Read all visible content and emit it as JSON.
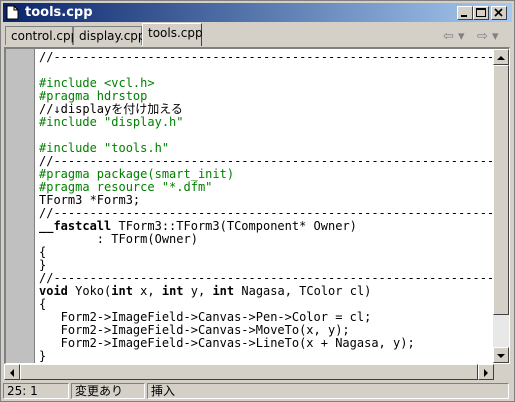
{
  "window": {
    "title": "tools.cpp",
    "icon": "document-icon"
  },
  "title_buttons": [
    "minimize-icon",
    "maximize-icon",
    "close-icon"
  ],
  "tabs": [
    {
      "label": "control.cpp",
      "active": false
    },
    {
      "label": "display.cpp",
      "active": false
    },
    {
      "label": "tools.cpp",
      "active": true
    }
  ],
  "nav": {
    "back": "⇦ ▾",
    "forward": "⇨ ▾"
  },
  "code": {
    "lines": [
      "//---------------------------------------------------------------------------",
      "",
      "#include <vcl.h>",
      "#pragma hdrstop",
      "//↓displayを付け加える",
      "#include \"display.h\"",
      "",
      "#include \"tools.h\"",
      "//---------------------------------------------------------------------------",
      "#pragma package(smart_init)",
      "#pragma resource \"*.dfm\"",
      "TForm3 *Form3;",
      "//---------------------------------------------------------------------------",
      "__fastcall TForm3::TForm3(TComponent* Owner)",
      "        : TForm(Owner)",
      "{",
      "}",
      "//---------------------------------------------------------------------------",
      "void Yoko(int x, int y, int Nagasa, TColor cl)",
      "{",
      "   Form2->ImageField->Canvas->Pen->Color = cl;",
      "   Form2->ImageField->Canvas->MoveTo(x, y);",
      "   Form2->ImageField->Canvas->LineTo(x + Nagasa, y);",
      "}"
    ]
  },
  "status": {
    "position": "25:   1",
    "modified": "変更あり",
    "mode": "挿入"
  },
  "colors": {
    "directive": "#008000",
    "title_start": "#0a246a",
    "title_end": "#a6caf0"
  }
}
